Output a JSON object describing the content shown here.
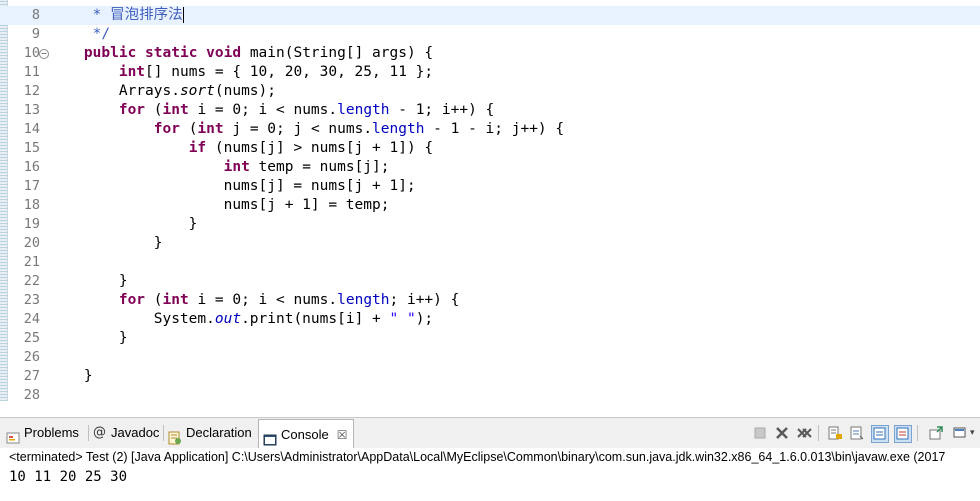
{
  "editor": {
    "lines": [
      {
        "n": "8",
        "segs": [
          {
            "t": "     * 冒泡排序法",
            "c": "comment"
          }
        ],
        "caret": true
      },
      {
        "n": "9",
        "segs": [
          {
            "t": "     */",
            "c": "comment"
          }
        ]
      },
      {
        "n": "10",
        "fold": "−",
        "segs": [
          {
            "t": "    "
          },
          {
            "t": "public",
            "c": "kw"
          },
          {
            "t": " "
          },
          {
            "t": "static",
            "c": "kw"
          },
          {
            "t": " "
          },
          {
            "t": "void",
            "c": "kw"
          },
          {
            "t": " main(String[] args) {"
          }
        ]
      },
      {
        "n": "11",
        "segs": [
          {
            "t": "        "
          },
          {
            "t": "int",
            "c": "kw"
          },
          {
            "t": "[] nums = { 10, 20, 30, 25, 11 };"
          }
        ]
      },
      {
        "n": "12",
        "segs": [
          {
            "t": "        Arrays."
          },
          {
            "t": "sort",
            "c": "static"
          },
          {
            "t": "(nums);"
          }
        ]
      },
      {
        "n": "13",
        "segs": [
          {
            "t": "        "
          },
          {
            "t": "for",
            "c": "kw"
          },
          {
            "t": " ("
          },
          {
            "t": "int",
            "c": "kw"
          },
          {
            "t": " i = 0; i < nums."
          },
          {
            "t": "length",
            "c": "field"
          },
          {
            "t": " - 1; i++) {"
          }
        ]
      },
      {
        "n": "14",
        "segs": [
          {
            "t": "            "
          },
          {
            "t": "for",
            "c": "kw"
          },
          {
            "t": " ("
          },
          {
            "t": "int",
            "c": "kw"
          },
          {
            "t": " j = 0; j < nums."
          },
          {
            "t": "length",
            "c": "field"
          },
          {
            "t": " - 1 - i; j++) {"
          }
        ]
      },
      {
        "n": "15",
        "segs": [
          {
            "t": "                "
          },
          {
            "t": "if",
            "c": "kw"
          },
          {
            "t": " (nums[j] > nums[j + 1]) {"
          }
        ]
      },
      {
        "n": "16",
        "segs": [
          {
            "t": "                    "
          },
          {
            "t": "int",
            "c": "kw"
          },
          {
            "t": " temp = nums[j];"
          }
        ]
      },
      {
        "n": "17",
        "segs": [
          {
            "t": "                    nums[j] = nums[j + 1];"
          }
        ]
      },
      {
        "n": "18",
        "segs": [
          {
            "t": "                    nums[j + 1] = temp;"
          }
        ]
      },
      {
        "n": "19",
        "segs": [
          {
            "t": "                }"
          }
        ]
      },
      {
        "n": "20",
        "segs": [
          {
            "t": "            }"
          }
        ]
      },
      {
        "n": "21",
        "segs": [
          {
            "t": ""
          }
        ]
      },
      {
        "n": "22",
        "segs": [
          {
            "t": "        }"
          }
        ]
      },
      {
        "n": "23",
        "segs": [
          {
            "t": "        "
          },
          {
            "t": "for",
            "c": "kw"
          },
          {
            "t": " ("
          },
          {
            "t": "int",
            "c": "kw"
          },
          {
            "t": " i = 0; i < nums."
          },
          {
            "t": "length",
            "c": "field"
          },
          {
            "t": "; i++) {"
          }
        ]
      },
      {
        "n": "24",
        "segs": [
          {
            "t": "            System."
          },
          {
            "t": "out",
            "c": "staticfield"
          },
          {
            "t": ".print(nums[i] + "
          },
          {
            "t": "\" \"",
            "c": "str"
          },
          {
            "t": ");"
          }
        ]
      },
      {
        "n": "25",
        "segs": [
          {
            "t": "        }"
          }
        ]
      },
      {
        "n": "26",
        "segs": [
          {
            "t": ""
          }
        ]
      },
      {
        "n": "27",
        "segs": [
          {
            "t": "    }"
          }
        ]
      },
      {
        "n": "28",
        "segs": [
          {
            "t": ""
          }
        ]
      }
    ]
  },
  "views": {
    "tabs": [
      {
        "id": "problems",
        "label": "Problems",
        "icon": "problems-icon",
        "active": false
      },
      {
        "id": "javadoc",
        "label": "Javadoc",
        "icon": "at-icon",
        "active": false
      },
      {
        "id": "declaration",
        "label": "Declaration",
        "icon": "declaration-icon",
        "active": false
      },
      {
        "id": "console",
        "label": "Console",
        "icon": "console-icon",
        "active": true,
        "close": "☒"
      }
    ],
    "colors": {
      "terminate": "#c8c8c8",
      "remove": "#5a5a5a",
      "pin": "#4f7fb8",
      "accent": "#2f6fb5"
    }
  },
  "console": {
    "status": "<terminated> Test (2) [Java Application] C:\\Users\\Administrator\\AppData\\Local\\MyEclipse\\Common\\binary\\com.sun.java.jdk.win32.x86_64_1.6.0.013\\bin\\javaw.exe (2017",
    "output": "10 11 20 25 30"
  }
}
